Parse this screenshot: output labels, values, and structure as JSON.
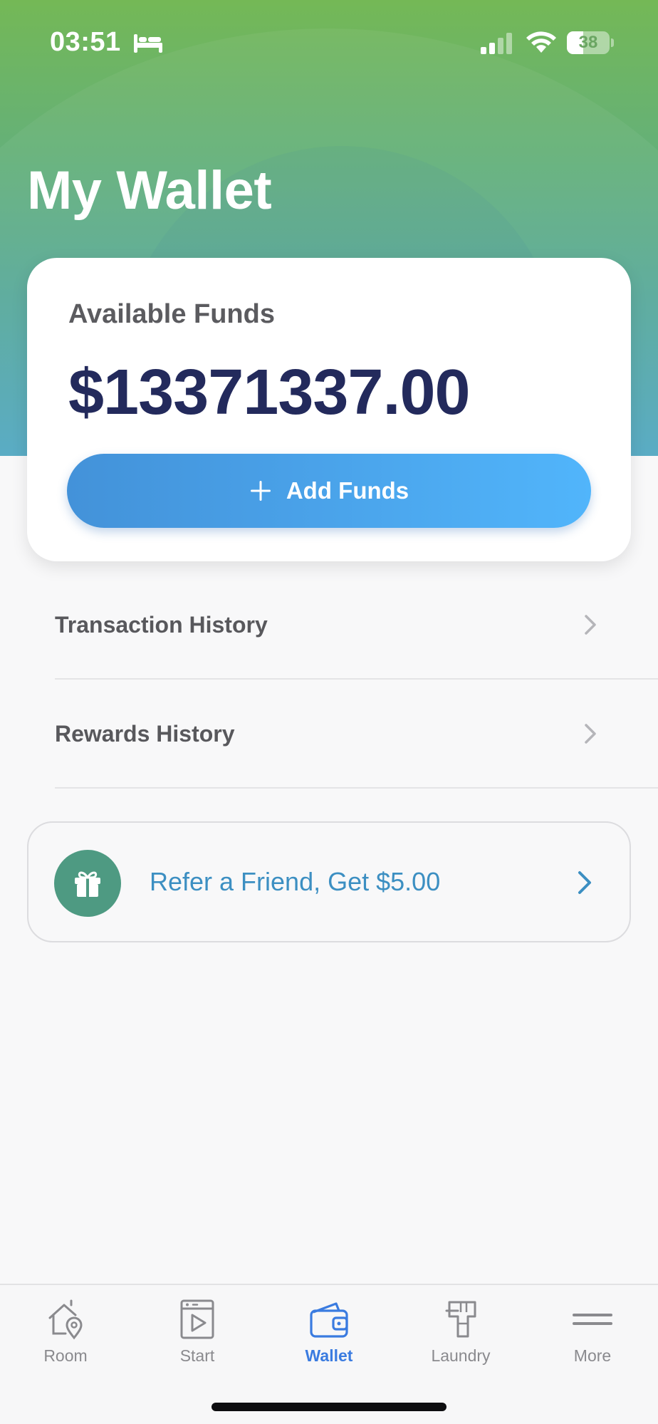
{
  "status_bar": {
    "time": "03:51",
    "battery_level": "38",
    "icons": [
      "bed-icon",
      "signal-icon",
      "wifi-icon",
      "battery-icon"
    ]
  },
  "page": {
    "title": "My Wallet"
  },
  "funds_card": {
    "label": "Available Funds",
    "amount": "$13371337.00",
    "add_funds_label": "Add Funds"
  },
  "menu": {
    "items": [
      {
        "label": "Transaction History",
        "icon": "chevron-right-icon"
      },
      {
        "label": "Rewards History",
        "icon": "chevron-right-icon"
      }
    ]
  },
  "referral": {
    "label": "Refer a Friend, Get $5.00",
    "icon": "gift-icon"
  },
  "tab_bar": {
    "active": "Wallet",
    "tabs": [
      {
        "label": "Room",
        "icon": "room-location-icon"
      },
      {
        "label": "Start",
        "icon": "start-machine-icon"
      },
      {
        "label": "Wallet",
        "icon": "wallet-icon"
      },
      {
        "label": "Laundry",
        "icon": "laundry-icon"
      },
      {
        "label": "More",
        "icon": "menu-lines-icon"
      }
    ]
  },
  "colors": {
    "header_gradient_top": "#74b856",
    "header_gradient_bottom": "#52a8c2",
    "amount_text": "#232a5c",
    "button_blue": "#4aa3ea",
    "referral_text": "#3c8fc2",
    "gift_circle": "#4e9a82",
    "active_tab": "#3a7be0"
  }
}
